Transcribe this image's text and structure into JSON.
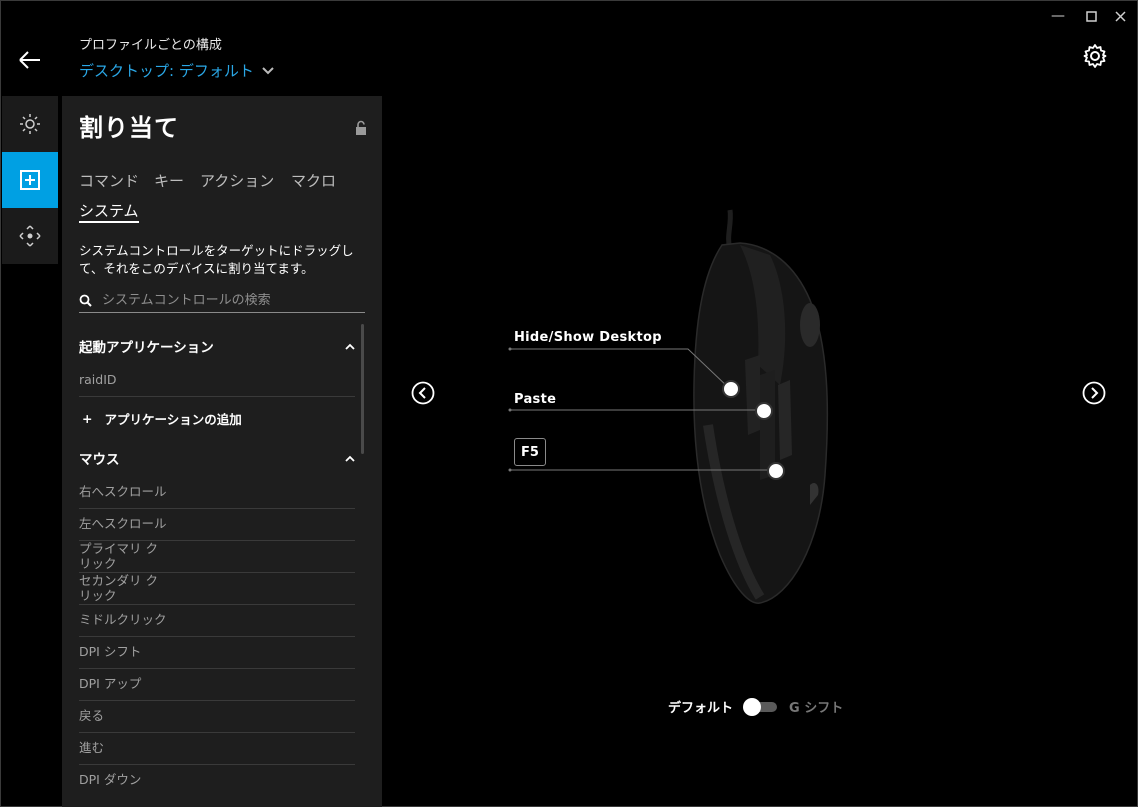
{
  "window": {
    "minimize": "—",
    "maximize": "☐",
    "close": "✕"
  },
  "header": {
    "subtitle": "プロファイルごとの構成",
    "profile": "デスクトップ: デフォルト"
  },
  "rail": {
    "icons": [
      "lighting-icon",
      "assign-icon",
      "dpi-icon"
    ],
    "active_index": 1
  },
  "panel": {
    "title": "割り当て",
    "tabs": [
      "コマンド",
      "キー",
      "アクション",
      "マクロ",
      "システム"
    ],
    "active_tab": "システム",
    "description": "システムコントロールをターゲットにドラッグして、それをこのデバイスに割り当てます。",
    "search_placeholder": "システムコントロールの検索",
    "sections": {
      "launch": {
        "title": "起動アプリケーション",
        "items": [
          "raidID"
        ],
        "add_label": "アプリケーションの追加"
      },
      "mouse": {
        "title": "マウス",
        "items": [
          "右へスクロール",
          "左へスクロール",
          "プライマリ ク\nリック",
          "セカンダリ ク\nリック",
          "ミドルクリック",
          "DPI シフト",
          "DPI アップ",
          "戻る",
          "進む",
          "DPI ダウン"
        ]
      }
    }
  },
  "device": {
    "assignments": [
      {
        "label": "Hide/Show Desktop"
      },
      {
        "label": "Paste"
      },
      {
        "label": "F5"
      }
    ]
  },
  "toggle": {
    "left": "デフォルト",
    "right": "G シフト",
    "state": "default"
  }
}
